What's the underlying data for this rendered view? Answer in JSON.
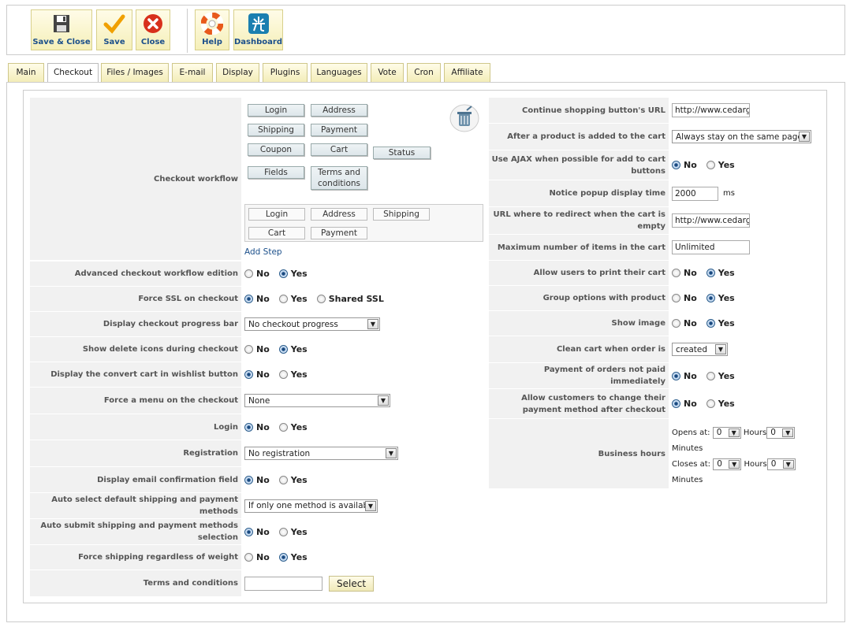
{
  "toolbar": {
    "save_close": "Save & Close",
    "save": "Save",
    "close": "Close",
    "help": "Help",
    "dashboard": "Dashboard"
  },
  "tabs": [
    "Main",
    "Checkout",
    "Files / Images",
    "E-mail",
    "Display",
    "Plugins",
    "Languages",
    "Vote",
    "Cron",
    "Affiliate"
  ],
  "left": {
    "checkout_workflow": "Checkout workflow",
    "wf_buttons": {
      "login": "Login",
      "address": "Address",
      "shipping": "Shipping",
      "payment": "Payment",
      "coupon": "Coupon",
      "cart": "Cart",
      "status": "Status",
      "fields": "Fields",
      "terms": "Terms and conditions"
    },
    "wf_step": {
      "login": "Login",
      "address": "Address",
      "shipping": "Shipping",
      "cart": "Cart",
      "payment": "Payment"
    },
    "add_step": "Add Step",
    "adv_workflow": "Advanced checkout workflow edition",
    "force_ssl": "Force SSL on checkout",
    "shared_ssl": "Shared SSL",
    "progress_bar": "Display checkout progress bar",
    "progress_bar_val": "No checkout progress",
    "delete_icons": "Show delete icons during checkout",
    "convert_cart": "Display the convert cart in wishlist button",
    "force_menu": "Force a menu on the checkout",
    "force_menu_val": "None",
    "login": "Login",
    "registration": "Registration",
    "registration_val": "No registration",
    "email_confirm": "Display email confirmation field",
    "auto_select": "Auto select default shipping and payment methods",
    "auto_select_val": "If only one method is available",
    "auto_submit": "Auto submit shipping and payment methods selection",
    "force_shipping": "Force shipping regardless of weight",
    "terms": "Terms and conditions",
    "select_btn": "Select"
  },
  "right": {
    "continue_url": "Continue shopping button's URL",
    "continue_url_val": "http://www.cedargat",
    "after_add": "After a product is added to the cart",
    "after_add_val": "Always stay on the same page",
    "use_ajax": "Use AJAX when possible for add to cart buttons",
    "notice_time": "Notice popup display time",
    "notice_time_val": "2000",
    "ms": "ms",
    "redirect_url": "URL where to redirect when the cart is empty",
    "redirect_url_val": "http://www.cedargat",
    "max_items": "Maximum number of items in the cart",
    "max_items_val": "Unlimited",
    "print_cart": "Allow users to print their cart",
    "group_options": "Group options with product",
    "show_image": "Show image",
    "clean_cart": "Clean cart when order is",
    "clean_cart_val": "created",
    "payment_not_paid": "Payment of orders not paid immediately",
    "change_payment": "Allow customers to change their payment method after checkout",
    "business_hours": "Business hours",
    "opens_at": "Opens at:",
    "closes_at": "Closes at:",
    "hours": "Hours",
    "minutes": "Minutes",
    "zero": "0"
  },
  "radio": {
    "no": "No",
    "yes": "Yes"
  },
  "colors": {
    "accent": "#1b4f8a",
    "tab_bg": "#f5efb8",
    "label_bg": "#f1f1f1"
  }
}
